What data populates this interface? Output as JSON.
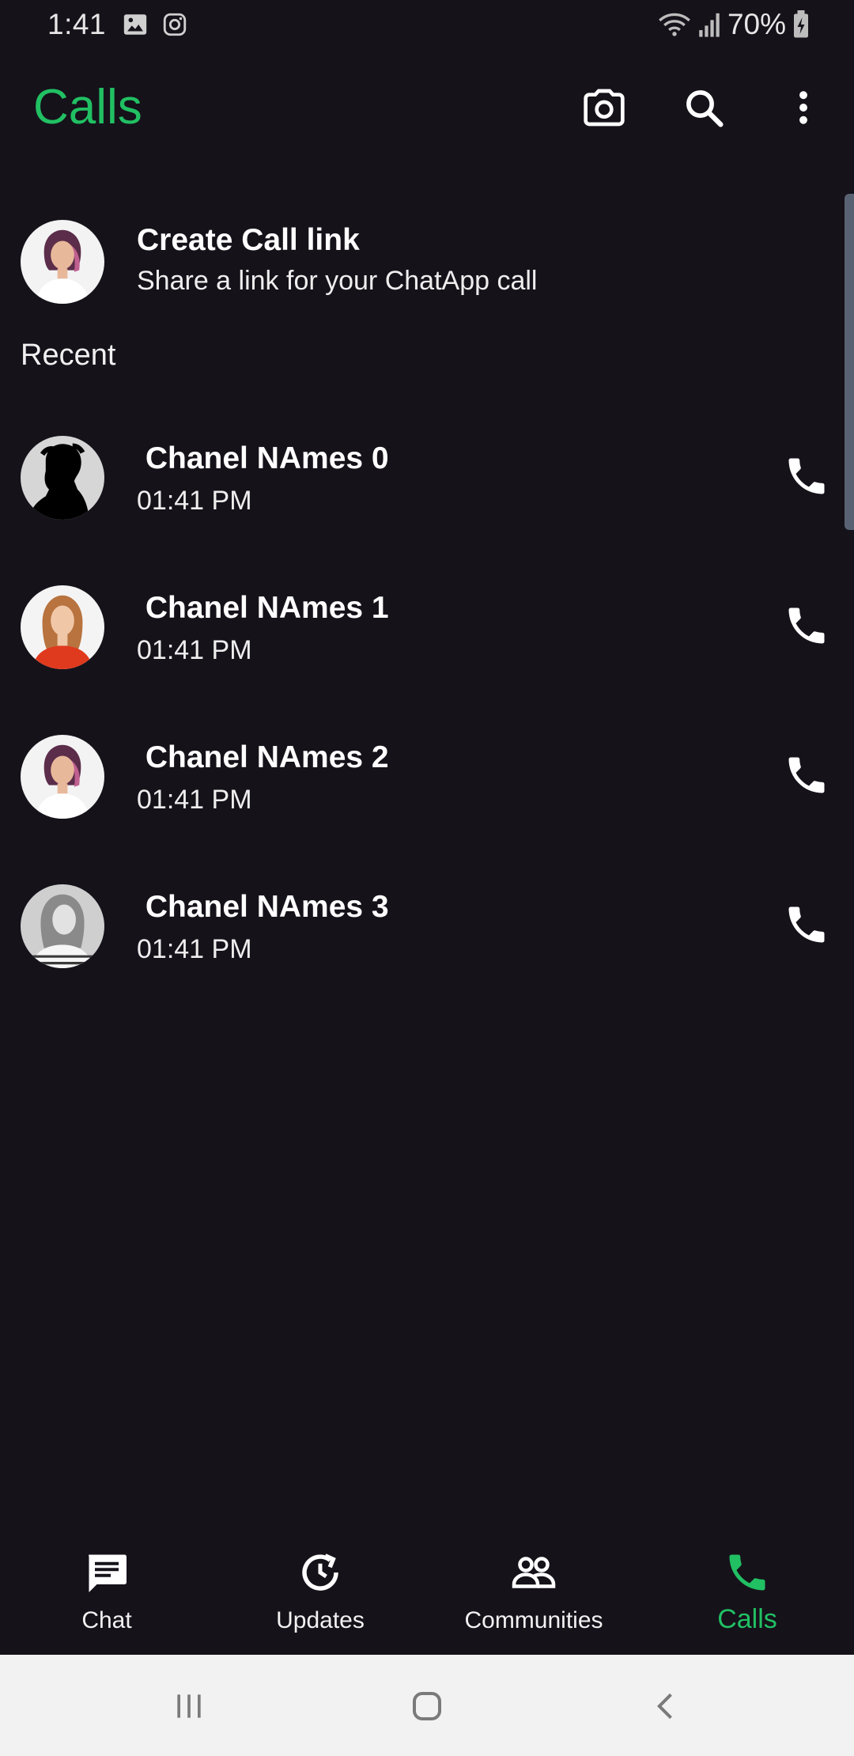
{
  "status_bar": {
    "time": "1:41",
    "battery": "70%",
    "icons_left": [
      "image-icon",
      "instagram-icon"
    ],
    "icons_right": [
      "wifi-icon",
      "signal-icon",
      "battery-charging-icon"
    ]
  },
  "app_bar": {
    "title": "Calls",
    "actions": [
      "camera-icon",
      "search-icon",
      "more-vert-icon"
    ]
  },
  "create_link": {
    "title": "Create Call link",
    "subtitle": "Share a link for your ChatApp call"
  },
  "section_label": "Recent",
  "calls": [
    {
      "name": " Chanel NAmes 0",
      "time": "01:41 PM"
    },
    {
      "name": " Chanel NAmes 1",
      "time": "01:41 PM"
    },
    {
      "name": " Chanel NAmes 2",
      "time": "01:41 PM"
    },
    {
      "name": " Chanel NAmes 3",
      "time": "01:41 PM"
    }
  ],
  "bottom_nav": [
    {
      "label": "Chat",
      "icon": "chat-icon",
      "active": false
    },
    {
      "label": "Updates",
      "icon": "updates-icon",
      "active": false
    },
    {
      "label": "Communities",
      "icon": "communities-icon",
      "active": false
    },
    {
      "label": "Calls",
      "icon": "phone-icon",
      "active": true
    }
  ],
  "colors": {
    "accent": "#21c063",
    "background": "#15121a",
    "system_nav": "#f2f2f2"
  }
}
